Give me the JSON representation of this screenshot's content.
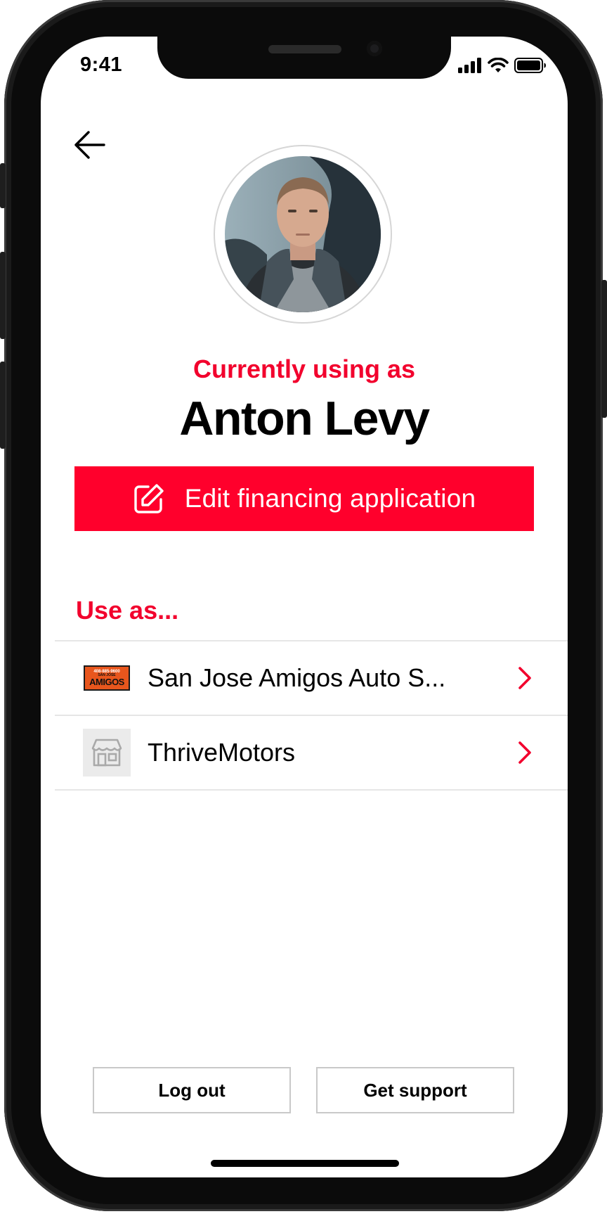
{
  "status_bar": {
    "time": "9:41",
    "icons": [
      "cellular-signal-icon",
      "wifi-icon",
      "battery-icon"
    ]
  },
  "header": {
    "back_icon": "back-arrow-icon"
  },
  "profile": {
    "subtitle": "Currently using as",
    "name": "Anton Levy",
    "edit_button_label": "Edit financing application",
    "edit_icon": "edit-pencil-icon"
  },
  "use_as": {
    "heading": "Use as...",
    "items": [
      {
        "label": "San Jose Amigos Auto S...",
        "logo_top": "408-885-9600",
        "logo_mid": "SAN JOSE",
        "logo_main": "AMIGOS",
        "chevron_icon": "chevron-right-icon"
      },
      {
        "label": "ThriveMotors",
        "logo_icon": "storefront-icon",
        "chevron_icon": "chevron-right-icon"
      }
    ]
  },
  "footer": {
    "logout_label": "Log out",
    "support_label": "Get support"
  },
  "colors": {
    "accent": "#ff002c",
    "accent_text": "#f2002d",
    "divider": "#e6e6e6",
    "button_border": "#c9c9c9"
  }
}
